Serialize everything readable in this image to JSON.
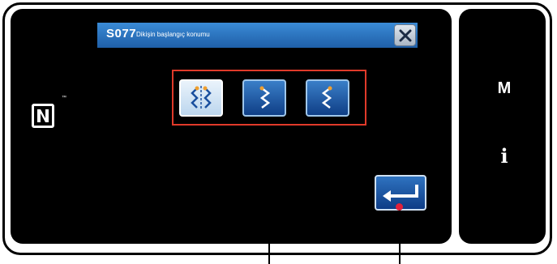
{
  "dialog": {
    "code": "S077",
    "title": "Dikişin başlangıç konumu",
    "close_icon": "close-icon"
  },
  "options": [
    {
      "icon": "sewing-start-both-sides-icon",
      "selected": true
    },
    {
      "icon": "sewing-start-right-icon",
      "selected": false
    },
    {
      "icon": "sewing-start-left-icon",
      "selected": false
    }
  ],
  "enter_icon": "enter-return-icon",
  "nfc_icon": "nfc-icon",
  "nfc_mark": "™",
  "side_panel": {
    "m_label": "M",
    "info_label": "i"
  },
  "colors": {
    "title_bar": "#2a73c4",
    "button_blue": "#1a4f9e",
    "selected_button": "#d8e8f6",
    "highlight_frame": "#e03a2a",
    "callout_dot": "#e0203a",
    "orange_marker": "#f0a030"
  }
}
